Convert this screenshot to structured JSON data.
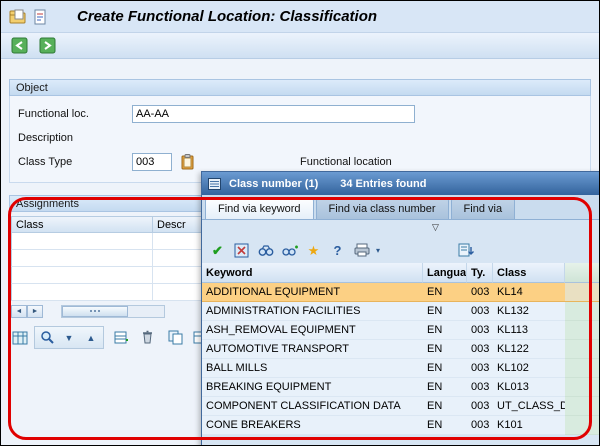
{
  "app": {
    "title": "Create Functional Location: Classification"
  },
  "object": {
    "section_title": "Object",
    "fields": {
      "functional_loc": {
        "label": "Functional loc.",
        "value": "AA-AA"
      },
      "description": {
        "label": "Description",
        "value": ""
      },
      "class_type": {
        "label": "Class Type",
        "value": "003",
        "description": "Functional location"
      }
    }
  },
  "assignments": {
    "section_title": "Assignments",
    "columns": [
      "Class",
      "Descr"
    ]
  },
  "icons": {
    "triangle_down": "▼",
    "triangle_up": "▲",
    "scroll_left": "◄",
    "scroll_right": "►",
    "open_triangle": "▽",
    "check": "✔",
    "cancel": "✕",
    "star": "★",
    "help": "?",
    "menu_arrow": "▾"
  },
  "popup": {
    "title": "Class number (1)",
    "entries": "34 Entries found",
    "tabs": [
      {
        "label": "Find via keyword"
      },
      {
        "label": "Find via class number"
      },
      {
        "label": "Find via"
      }
    ],
    "table": {
      "headers": {
        "keyword": "Keyword",
        "language": "Language",
        "ty": "Ty.",
        "class": "Class"
      },
      "rows": [
        {
          "keyword": "ADDITIONAL EQUIPMENT",
          "language": "EN",
          "ty": "003",
          "class": "KL14"
        },
        {
          "keyword": "ADMINISTRATION FACILITIES",
          "language": "EN",
          "ty": "003",
          "class": "KL132"
        },
        {
          "keyword": "ASH_REMOVAL EQUIPMENT",
          "language": "EN",
          "ty": "003",
          "class": "KL113"
        },
        {
          "keyword": "AUTOMOTIVE TRANSPORT",
          "language": "EN",
          "ty": "003",
          "class": "KL122"
        },
        {
          "keyword": "BALL MILLS",
          "language": "EN",
          "ty": "003",
          "class": "KL102"
        },
        {
          "keyword": "BREAKING EQUIPMENT",
          "language": "EN",
          "ty": "003",
          "class": "KL013"
        },
        {
          "keyword": "COMPONENT CLASSIFICATION DATA",
          "language": "EN",
          "ty": "003",
          "class": "UT_CLASS_DA"
        },
        {
          "keyword": "CONE BREAKERS",
          "language": "EN",
          "ty": "003",
          "class": "K101"
        }
      ]
    }
  }
}
